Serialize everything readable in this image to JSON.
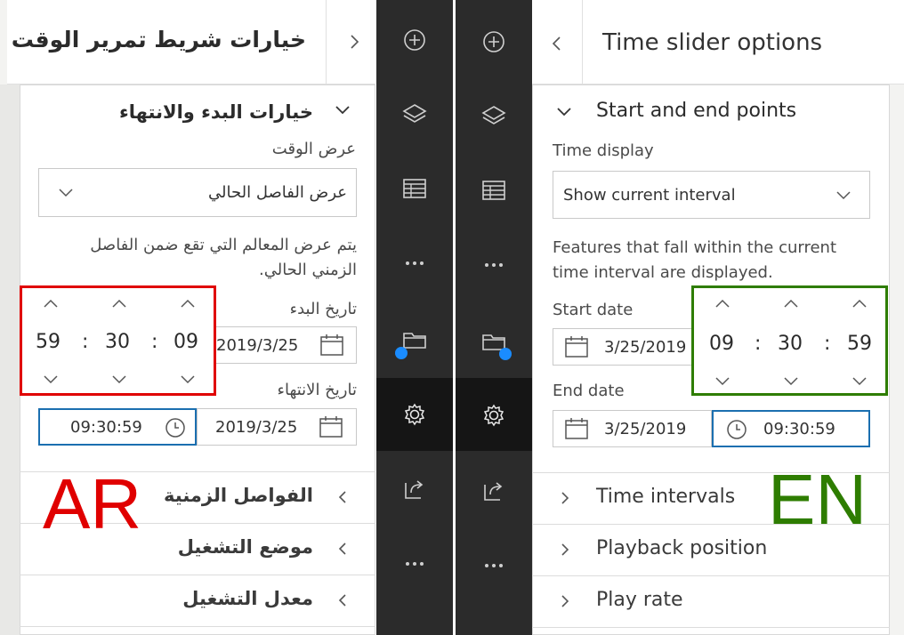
{
  "ar": {
    "header_title": "خيارات شريط تمرير الوقت",
    "section_title": "خيارات البدء والانتهاء",
    "time_display_label": "عرض الوقت",
    "time_display_value": "عرض الفاصل الحالي",
    "description_line1": "يتم عرض المعالم التي تقع ضمن الفاصل",
    "description_line2": "الزمني الحالي.",
    "start_date_label": "تاريخ البدء",
    "start_date_value": "2019/3/25",
    "end_date_label": "تاريخ الانتهاء",
    "end_date_value": "2019/3/25",
    "end_time_value": "09:30:59",
    "picker": {
      "first": "59",
      "sep1": ":",
      "middle": "30",
      "sep2": ":",
      "last": "09"
    },
    "collapsed_sections": [
      "الفواصل الزمنية",
      "موضع التشغيل",
      "معدل التشغيل"
    ],
    "tag": "AR"
  },
  "en": {
    "header_title": "Time slider options",
    "section_title": "Start and end points",
    "time_display_label": "Time display",
    "time_display_value": "Show current interval",
    "description_line1": "Features that fall within the current",
    "description_line2": "time interval are displayed.",
    "start_date_label": "Start date",
    "start_date_value": "3/25/2019",
    "end_date_label": "End date",
    "end_date_value": "3/25/2019",
    "end_time_value": "09:30:59",
    "picker": {
      "first": "09",
      "sep1": ":",
      "middle": "30",
      "sep2": ":",
      "last": "59"
    },
    "collapsed_sections": [
      "Time intervals",
      "Playback position",
      "Play rate"
    ],
    "tag": "EN"
  },
  "rail_icons": [
    "add-icon",
    "layers-icon",
    "table-icon",
    "more-icon",
    "folder-icon",
    "settings-icon",
    "share-icon",
    "more-icon"
  ],
  "colors": {
    "ar_highlight": "#e00000",
    "en_highlight": "#2e7d00",
    "focus_blue": "#1b6fb0",
    "rail_dark": "#2b2b2b",
    "rail_active": "#151515",
    "notification_dot": "#1a8cff"
  }
}
